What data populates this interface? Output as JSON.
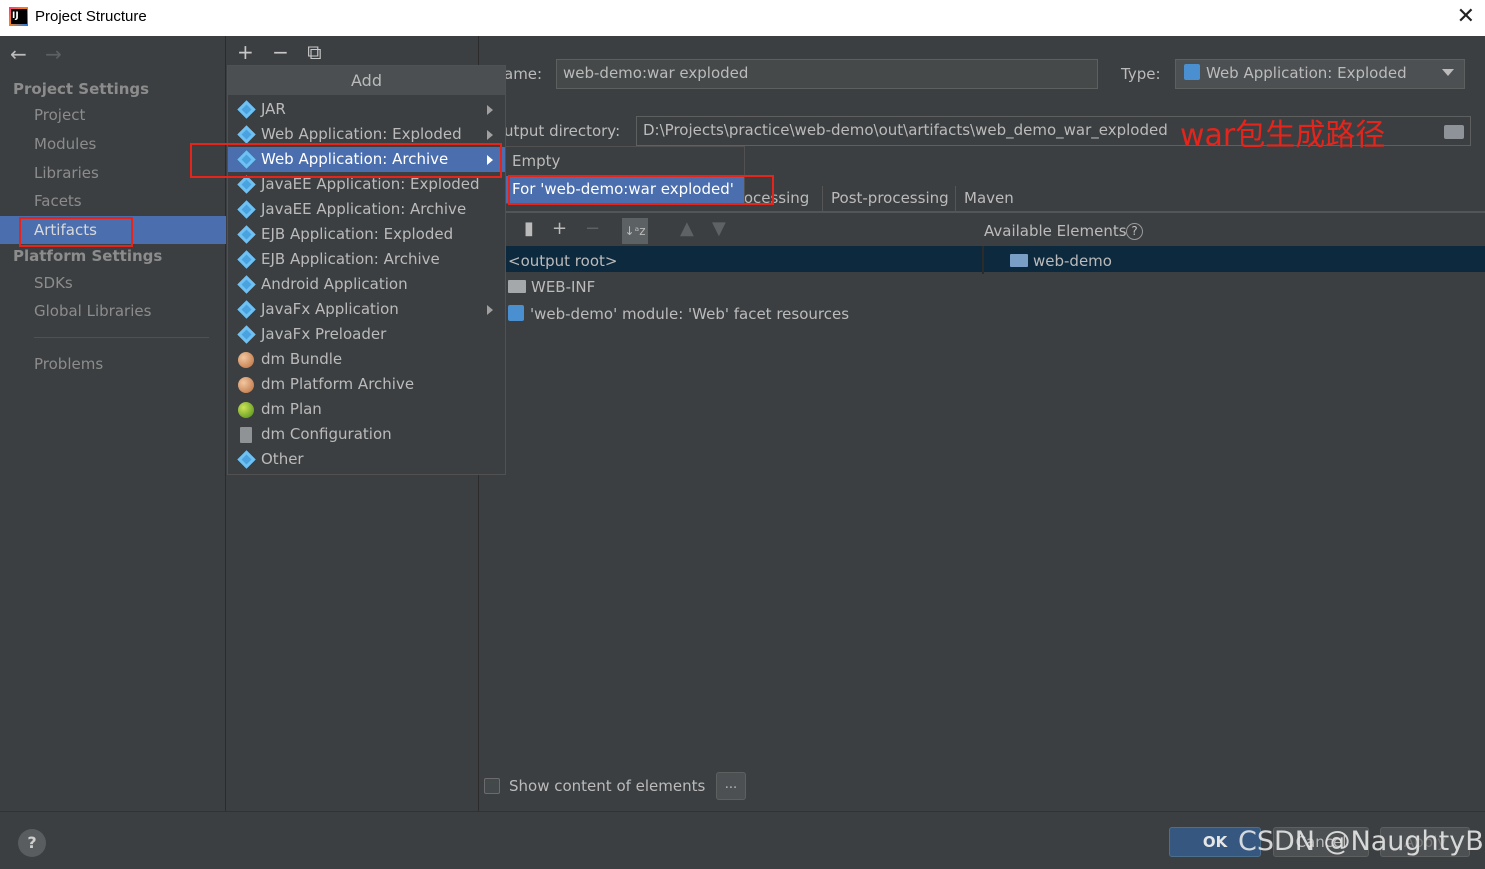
{
  "window": {
    "title": "Project Structure"
  },
  "nav": {
    "back": "←",
    "forward": "→"
  },
  "sidebar": {
    "project_settings": "Project Settings",
    "project_items": [
      "Project",
      "Modules",
      "Libraries",
      "Facets"
    ],
    "selected_item": "Artifacts",
    "platform_settings": "Platform Settings",
    "platform_items": [
      "SDKs",
      "Global Libraries"
    ],
    "problems": "Problems"
  },
  "middle": {
    "add": "+",
    "remove": "−",
    "copy": "⧉"
  },
  "add_menu": {
    "title": "Add",
    "items": [
      {
        "label": "JAR",
        "icon": "jar-diamond-icon",
        "submenu": true
      },
      {
        "label": "Web Application: Exploded",
        "icon": "web-app-icon",
        "submenu": true
      },
      {
        "label": "Web Application: Archive",
        "icon": "web-app-icon",
        "submenu": true
      },
      {
        "label": "JavaEE Application: Exploded",
        "icon": "javaee-icon",
        "submenu": false
      },
      {
        "label": "JavaEE Application: Archive",
        "icon": "javaee-icon",
        "submenu": false
      },
      {
        "label": "EJB Application: Exploded",
        "icon": "ejb-icon",
        "submenu": false
      },
      {
        "label": "EJB Application: Archive",
        "icon": "ejb-icon",
        "submenu": false
      },
      {
        "label": "Android Application",
        "icon": "android-diamond-icon",
        "submenu": false
      },
      {
        "label": "JavaFx Application",
        "icon": "javafx-diamond-icon",
        "submenu": true
      },
      {
        "label": "JavaFx Preloader",
        "icon": "javafx-diamond-icon",
        "submenu": false
      },
      {
        "label": "dm Bundle",
        "icon": "dm-bundle-icon",
        "submenu": false
      },
      {
        "label": "dm Platform Archive",
        "icon": "dm-bundle-icon",
        "submenu": false
      },
      {
        "label": "dm Plan",
        "icon": "dm-plan-icon",
        "submenu": false
      },
      {
        "label": "dm Configuration",
        "icon": "config-file-icon",
        "submenu": false
      },
      {
        "label": "Other",
        "icon": "other-diamond-icon",
        "submenu": false
      }
    ],
    "selected": "Web Application: Archive"
  },
  "submenu": {
    "items": [
      "Empty",
      "For 'web-demo:war exploded'"
    ],
    "selected": "For 'web-demo:war exploded'"
  },
  "artifact": {
    "name_label": "ame:",
    "name_value": "web-demo:war exploded",
    "type_label": "Type:",
    "type_value": "Web Application: Exploded",
    "output_label": "utput directory:",
    "output_value": "D:\\Projects\\practice\\web-demo\\out\\artifacts\\web_demo_war_exploded",
    "annotation": "war包生成路径"
  },
  "tabs": [
    "rocessing",
    "Post-processing",
    "Maven"
  ],
  "layout_tree": {
    "available_label": "Available Elements",
    "available_help": "?",
    "root": "<output root>",
    "available_root": "web-demo",
    "rows": [
      "WEB-INF",
      "'web-demo' module: 'Web' facet resources"
    ]
  },
  "show_content": {
    "label": "Show content of elements",
    "dots": "..."
  },
  "buttons": {
    "help": "?",
    "ok": "OK",
    "cancel": "Cancel",
    "apply": "Apply"
  },
  "watermark": "CSDN @NaughtyBo",
  "colors": {
    "selection": "#4b6eaf",
    "annotation": "#e5241c",
    "background": "#3c3f41"
  }
}
